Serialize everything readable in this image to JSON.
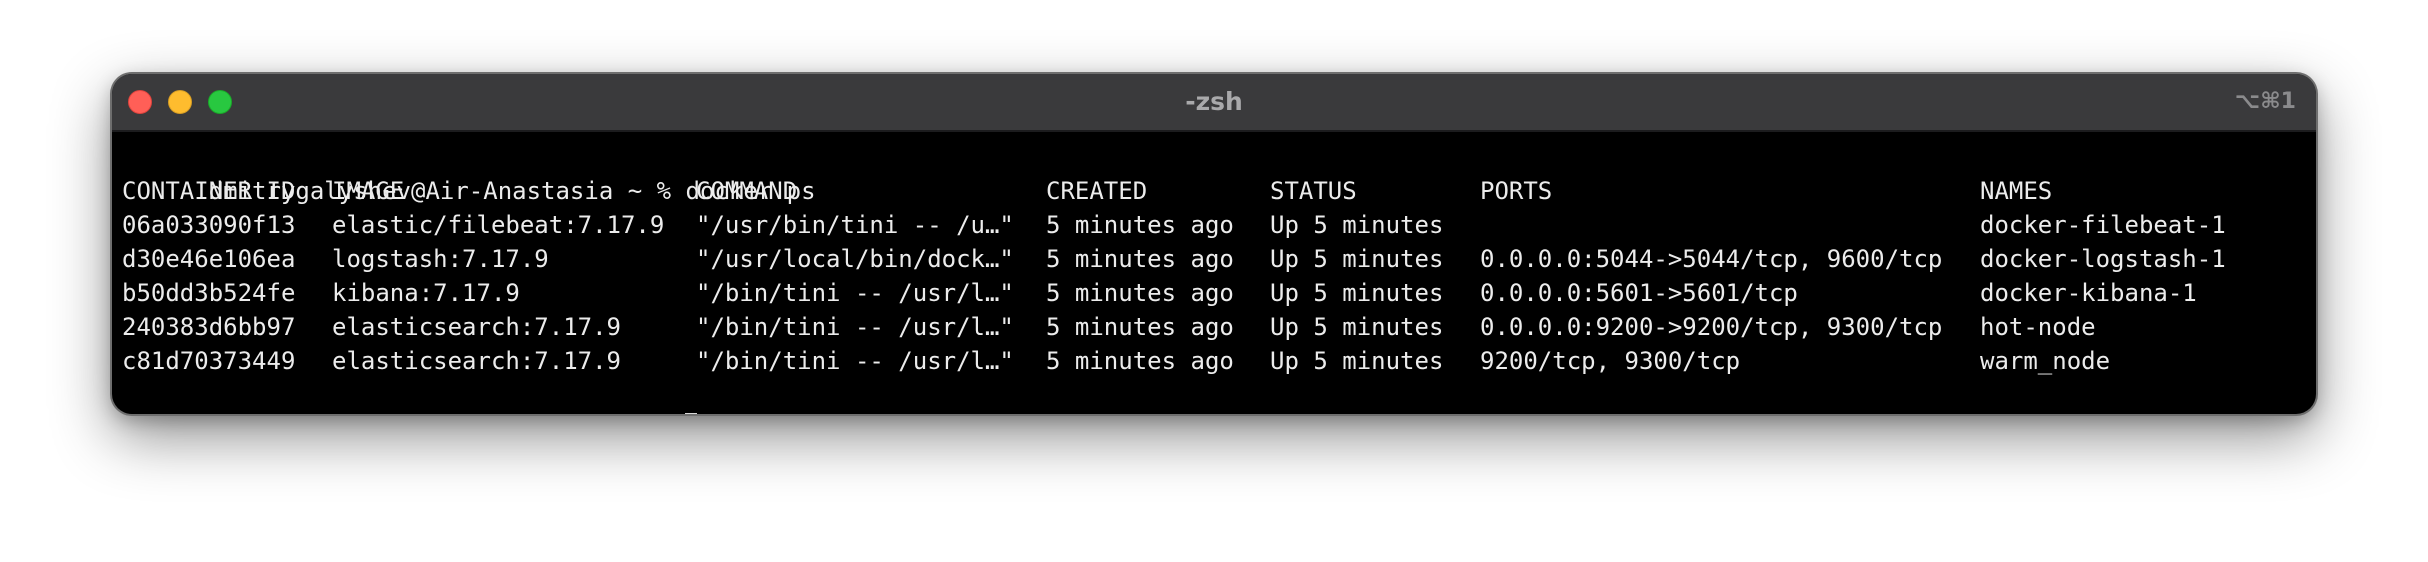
{
  "window": {
    "title": "-zsh",
    "shortcut": "⌥⌘1"
  },
  "prompt": "dmitrygalyshev@Air-Anastasia ~ %",
  "command": "docker ps",
  "headers": [
    "CONTAINER ID",
    "IMAGE",
    "COMMAND",
    "CREATED",
    "STATUS",
    "PORTS",
    "NAMES"
  ],
  "rows": [
    [
      "06a033090f13",
      "elastic/filebeat:7.17.9",
      "\"/usr/bin/tini -- /u…\"",
      "5 minutes ago",
      "Up 5 minutes",
      "",
      "docker-filebeat-1"
    ],
    [
      "d30e46e106ea",
      "logstash:7.17.9",
      "\"/usr/local/bin/dock…\"",
      "5 minutes ago",
      "Up 5 minutes",
      "0.0.0.0:5044->5044/tcp, 9600/tcp",
      "docker-logstash-1"
    ],
    [
      "b50dd3b524fe",
      "kibana:7.17.9",
      "\"/bin/tini -- /usr/l…\"",
      "5 minutes ago",
      "Up 5 minutes",
      "0.0.0.0:5601->5601/tcp",
      "docker-kibana-1"
    ],
    [
      "240383d6bb97",
      "elasticsearch:7.17.9",
      "\"/bin/tini -- /usr/l…\"",
      "5 minutes ago",
      "Up 5 minutes",
      "0.0.0.0:9200->9200/tcp, 9300/tcp",
      "hot-node"
    ],
    [
      "c81d70373449",
      "elasticsearch:7.17.9",
      "\"/bin/tini -- /usr/l…\"",
      "5 minutes ago",
      "Up 5 minutes",
      "9200/tcp, 9300/tcp",
      "warm_node"
    ]
  ],
  "colors": {
    "close": "#ff5f57",
    "minimize": "#febc2e",
    "maximize": "#28c840",
    "background": "#000000",
    "foreground": "#ececec"
  }
}
